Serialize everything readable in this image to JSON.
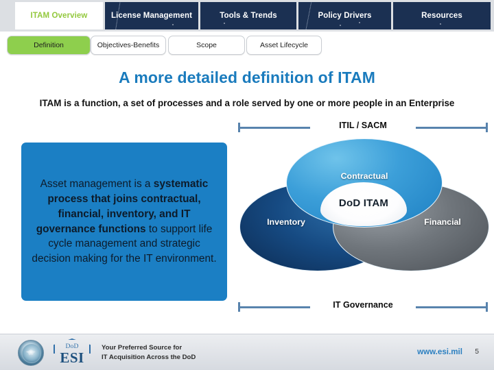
{
  "nav": {
    "tabs": [
      {
        "label": "ITAM Overview",
        "active": true
      },
      {
        "label": "License Management",
        "active": false
      },
      {
        "label": "Tools & Trends",
        "active": false
      },
      {
        "label": "Policy Drivers",
        "active": false
      },
      {
        "label": "Resources",
        "active": false
      }
    ]
  },
  "subnav": {
    "tabs": [
      {
        "label": "Definition",
        "selected": true
      },
      {
        "label": "Objectives-Benefits",
        "selected": false
      },
      {
        "label": "Scope",
        "selected": false
      },
      {
        "label": "Asset Lifecycle",
        "selected": false
      }
    ]
  },
  "slide": {
    "title": "A more detailed definition of ITAM",
    "subtitle": "ITAM is a function, a set of processes and a role served by one or more people in an Enterprise"
  },
  "definition_panel": {
    "segments": [
      {
        "text": "Asset management is a ",
        "bold": false
      },
      {
        "text": "systematic process that joins contractual, financial, inventory, and IT governance functions",
        "bold": true
      },
      {
        "text": " to support life cycle management and strategic decision making for the IT environment.",
        "bold": false
      }
    ],
    "plain_text": "Asset management is a systematic process that joins contractual, financial, inventory, and IT governance functions to support life cycle management and strategic decision making for the IT environment."
  },
  "venn": {
    "top_bracket_label": "ITIL / SACM",
    "bottom_bracket_label": "IT Governance",
    "center_label": "DoD ITAM",
    "circles": [
      {
        "label": "Contractual",
        "color": "#3c9fd9"
      },
      {
        "label": "Inventory",
        "color": "#164a82"
      },
      {
        "label": "Financial",
        "color": "#70767c"
      }
    ]
  },
  "footer": {
    "seal_icon": "dod-seal-icon",
    "logo_dod": "DoD",
    "logo_esi": "ESI",
    "tagline_line1": "Your Preferred Source for",
    "tagline_line2": "IT Acquisition Across the DoD",
    "website": "www.esi.mil",
    "page_number": "5"
  },
  "colors": {
    "nav_navy": "#1b3052",
    "accent_green": "#8ecf4d",
    "title_blue": "#1a7bbd",
    "panel_blue": "#1b7fc4",
    "bracket_blue": "#5883ad"
  }
}
